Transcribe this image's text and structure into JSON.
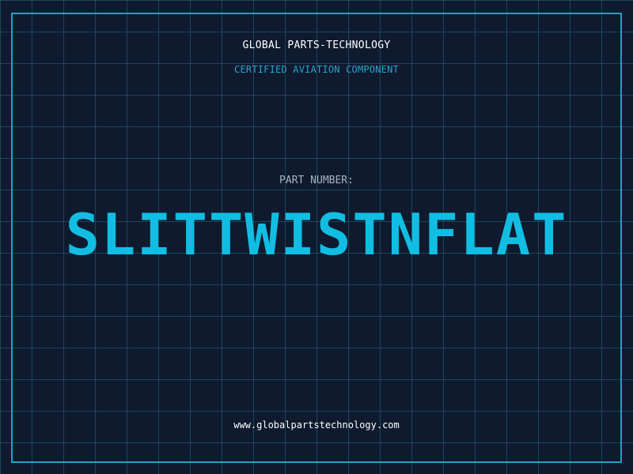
{
  "header": {
    "company": "GLOBAL PARTS-TECHNOLOGY",
    "subtitle": "CERTIFIED AVIATION COMPONENT"
  },
  "part": {
    "label": "PART NUMBER:",
    "number": "SLITTWISTNFLAT"
  },
  "footer": {
    "url": "www.globalpartstechnology.com"
  },
  "colors": {
    "background": "#0f1a2e",
    "grid": "#26687c",
    "frame": "#1fa3c4",
    "accent": "#12bde3"
  }
}
